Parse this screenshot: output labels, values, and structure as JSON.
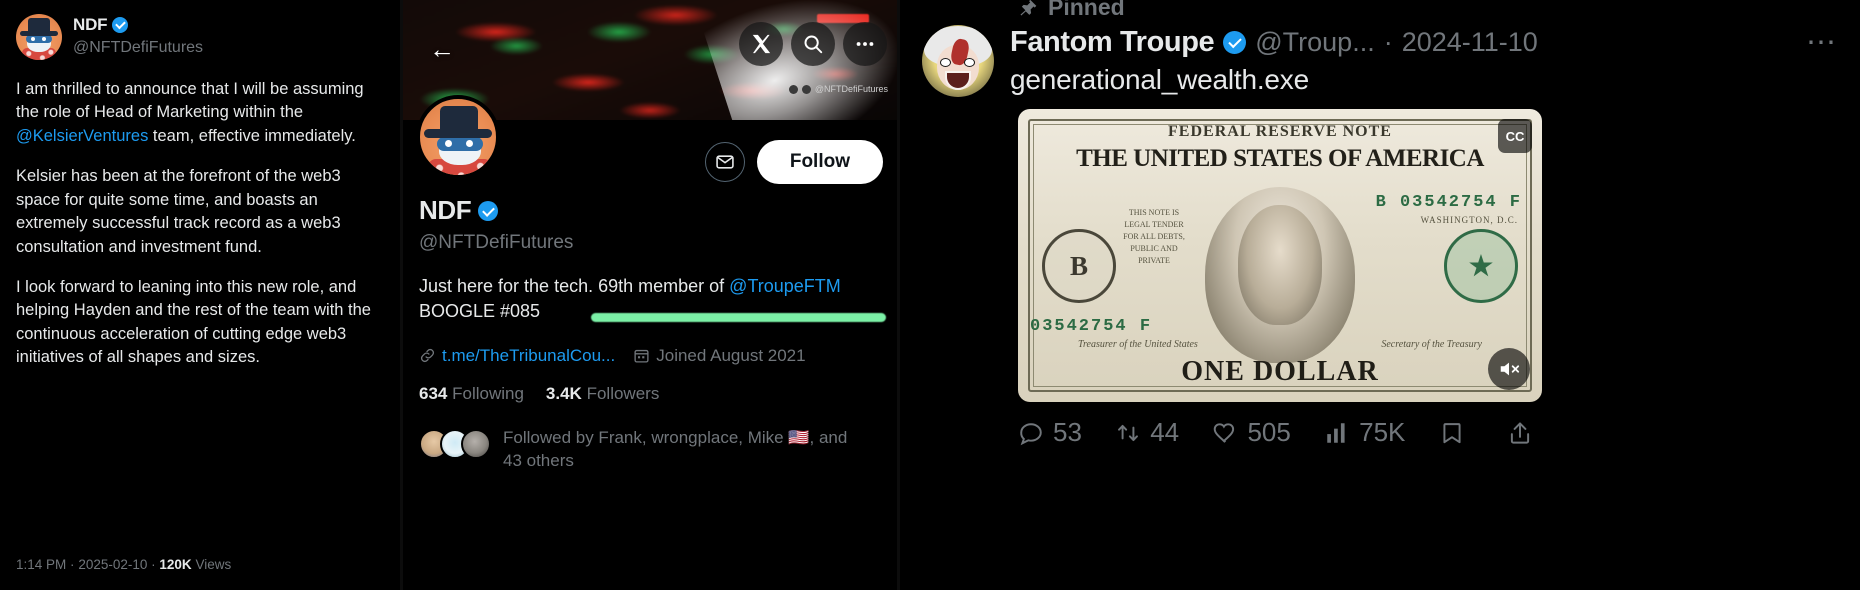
{
  "tweet": {
    "author_name": "NDF",
    "author_handle": "@NFTDefiFutures",
    "verified_icon": "verified-badge-icon",
    "avatar_icon": "ndf-avatar",
    "paragraphs": [
      "I am thrilled to announce that I will be assuming the role of Head of Marketing within the ",
      "Kelsier has been at the forefront of the web3 space for quite some time, and boasts an extremely successful track record as a web3 consultation and investment fund.",
      "I look forward to leaning into this new role, and helping Hayden and the rest of the team with the continuous acceleration of cutting edge web3 initiatives of all shapes and sizes."
    ],
    "mention": "@KelsierVentures",
    "paragraph1_tail": " team, effective immediately.",
    "time": "1:14 PM",
    "sep1": "·",
    "date": "2025-02-10",
    "sep2": "·",
    "views_count": "120K",
    "views_label": "Views"
  },
  "profile": {
    "back_icon": "back-arrow-icon",
    "banner_icon": "candlestick-chart-banner",
    "top_icons": [
      {
        "name": "x-premium-icon",
        "glyph": "X"
      },
      {
        "name": "search-icon",
        "glyph": "search"
      },
      {
        "name": "more-options-icon",
        "glyph": "more"
      }
    ],
    "watermark": "@NFTDefiFutures",
    "avatar_icon": "ndf-profile-avatar",
    "message_icon": "envelope-icon",
    "follow_label": "Follow",
    "name": "NDF",
    "verified_icon": "verified-badge-icon",
    "handle": "@NFTDefiFutures",
    "bio_prefix": "Just here for the tech. 69th member of ",
    "bio_mention": "@TroupeFTM",
    "bio_line2": "BOOGLE #085",
    "highlight_color": "#7bf0a6",
    "link_icon": "link-icon",
    "link_text": "t.me/TheTribunalCou...",
    "calendar_icon": "calendar-icon",
    "joined_text": "Joined August 2021",
    "following_count": "634",
    "following_label": "Following",
    "followers_count": "3.4K",
    "followers_label": "Followers",
    "followed_by_line1": "Followed by Frank, wrongplace, Mike 🇺🇸, and",
    "followed_by_line2": "43 others"
  },
  "pinned": {
    "pin_icon": "pin-icon",
    "pinned_label": "Pinned",
    "avatar_icon": "fantom-troupe-avatar",
    "name": "Fantom Troupe",
    "verified_icon": "verified-badge-icon",
    "handle": "@Troup...",
    "dot": "·",
    "date": "2024-11-10",
    "more_icon": "more-options-icon",
    "text": "generational_wealth.exe",
    "media": {
      "name": "dollar-bill-video",
      "top_line": "FEDERAL RESERVE NOTE",
      "title": "THE UNITED STATES OF AMERICA",
      "seal_left": "B",
      "serial_top": "B 03542754 F",
      "serial_bottom": "03542754 F",
      "washington": "WASHINGTON, D.C.",
      "legal": "THIS NOTE IS LEGAL TENDER FOR ALL DEBTS, PUBLIC AND PRIVATE",
      "bottom_line": "ONE DOLLAR",
      "sig_left": "Treasurer of the United States",
      "sig_right": "Secretary of the Treasury",
      "cc_badge": "CC",
      "cc_icon": "closed-caption-icon",
      "mute_icon": "mute-icon"
    },
    "actions": [
      {
        "name": "reply-button",
        "icon": "comment-icon",
        "count": "53"
      },
      {
        "name": "retweet-button",
        "icon": "retweet-icon",
        "count": "44"
      },
      {
        "name": "like-button",
        "icon": "heart-icon",
        "count": "505"
      },
      {
        "name": "views-button",
        "icon": "analytics-icon",
        "count": "75K"
      },
      {
        "name": "bookmark-button",
        "icon": "bookmark-icon",
        "count": ""
      },
      {
        "name": "share-button",
        "icon": "share-icon",
        "count": ""
      }
    ]
  }
}
